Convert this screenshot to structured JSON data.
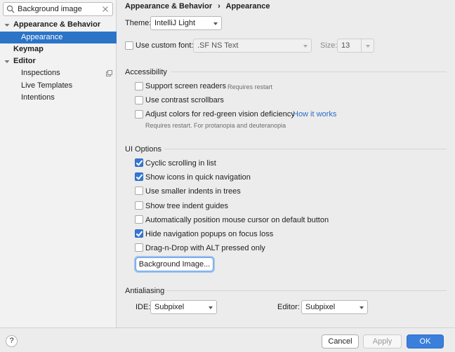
{
  "search": {
    "value": "Background image"
  },
  "tree": [
    {
      "label": "Appearance & Behavior",
      "bold": true,
      "expanded": true
    },
    {
      "label": "Appearance",
      "selected": true
    },
    {
      "label": "Keymap",
      "bold": true
    },
    {
      "label": "Editor",
      "bold": true,
      "expanded": true
    },
    {
      "label": "Inspections"
    },
    {
      "label": "Live Templates"
    },
    {
      "label": "Intentions"
    }
  ],
  "breadcrumb": {
    "parent": "Appearance & Behavior",
    "separator": "›",
    "current": "Appearance"
  },
  "theme": {
    "label": "Theme:",
    "value": "IntelliJ Light"
  },
  "font": {
    "checkbox_label": "Use custom font:",
    "value": ".SF NS Text",
    "size_label": "Size:",
    "size_value": "13",
    "checked": false
  },
  "accessibility": {
    "title": "Accessibility",
    "screen_readers": {
      "label": "Support screen readers",
      "note": "Requires restart",
      "checked": false
    },
    "contrast_scrollbars": {
      "label": "Use contrast scrollbars",
      "checked": false
    },
    "adjust_colors": {
      "label": "Adjust colors for red-green vision deficiency",
      "link": "How it works",
      "note": "Requires restart. For protanopia and deuteranopia",
      "checked": false
    }
  },
  "ui_options": {
    "title": "UI Options",
    "items": [
      {
        "label": "Cyclic scrolling in list",
        "checked": true
      },
      {
        "label": "Show icons in quick navigation",
        "checked": true
      },
      {
        "label": "Use smaller indents in trees",
        "checked": false
      },
      {
        "label": "Show tree indent guides",
        "checked": false
      },
      {
        "label": "Automatically position mouse cursor on default button",
        "checked": false
      },
      {
        "label": "Hide navigation popups on focus loss",
        "checked": true
      },
      {
        "label": "Drag-n-Drop with ALT pressed only",
        "checked": false
      }
    ],
    "background_button": "Background Image..."
  },
  "antialiasing": {
    "title": "Antialiasing",
    "ide_label": "IDE:",
    "ide_value": "Subpixel",
    "editor_label": "Editor:",
    "editor_value": "Subpixel"
  },
  "footer": {
    "help": "?",
    "cancel": "Cancel",
    "apply": "Apply",
    "ok": "OK"
  }
}
